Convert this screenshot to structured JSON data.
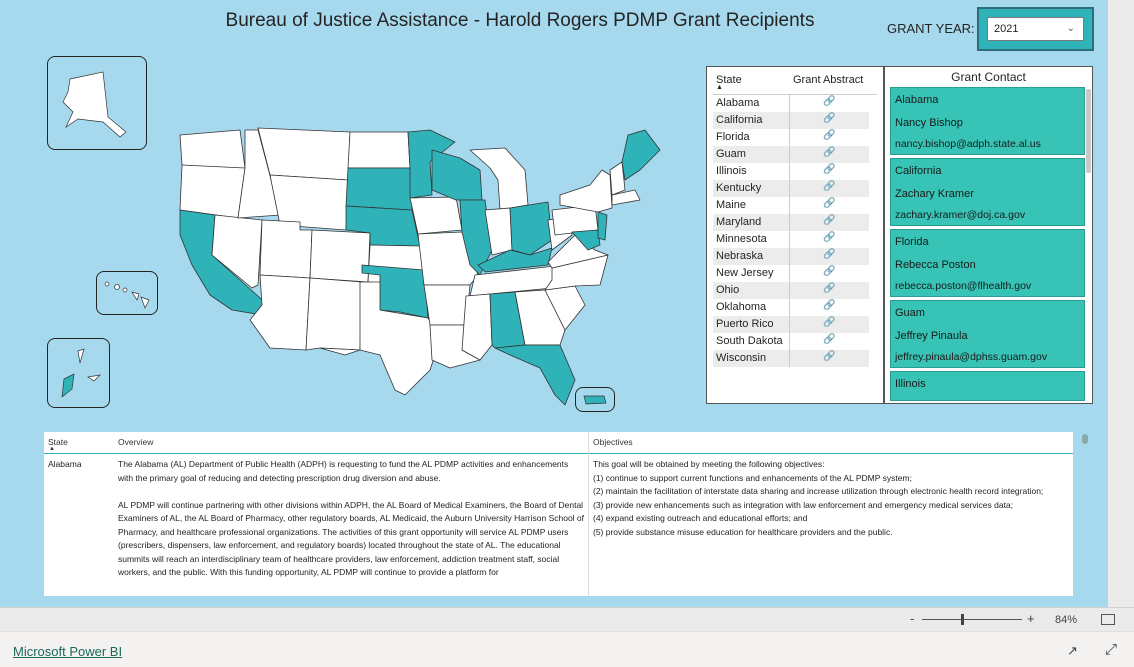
{
  "report": {
    "title": "Bureau of Justice Assistance - Harold Rogers PDMP Grant Recipients",
    "grant_year_label": "GRANT YEAR:",
    "grant_year_value": "2021"
  },
  "colors": {
    "canvas": "#a6d9ee",
    "highlight": "#2fb3b9",
    "state_fill": "#ffffff"
  },
  "state_table": {
    "headers": [
      "State",
      "Grant Abstract"
    ],
    "sort_indicator": "▲",
    "link_icon": "link-icon",
    "rows": [
      "Alabama",
      "California",
      "Florida",
      "Guam",
      "Illinois",
      "Kentucky",
      "Maine",
      "Maryland",
      "Minnesota",
      "Nebraska",
      "New Jersey",
      "Ohio",
      "Oklahoma",
      "Puerto Rico",
      "South Dakota",
      "Wisconsin"
    ]
  },
  "grant_contact": {
    "title": "Grant Contact",
    "cards": [
      {
        "state": "Alabama",
        "name": "Nancy Bishop",
        "email": "nancy.bishop@adph.state.al.us"
      },
      {
        "state": "California",
        "name": "Zachary Kramer",
        "email": "zachary.kramer@doj.ca.gov"
      },
      {
        "state": "Florida",
        "name": "Rebecca Poston",
        "email": "rebecca.poston@flhealth.gov"
      },
      {
        "state": "Guam",
        "name": "Jeffrey Pinaula",
        "email": "jeffrey.pinaula@dphss.guam.gov"
      },
      {
        "state": "Illinois"
      }
    ]
  },
  "details": {
    "headers": {
      "state": "State",
      "overview": "Overview",
      "objectives": "Objectives"
    },
    "row": {
      "state": "Alabama",
      "overview_p1": "The Alabama (AL) Department of Public Health (ADPH) is requesting to fund the AL PDMP activities and enhancements with the primary goal of reducing and detecting prescription drug diversion and abuse.",
      "overview_p2": "AL PDMP will continue partnering with other divisions within ADPH, the AL Board of Medical Examiners, the Board of Dental Examiners of AL, the AL Board of Pharmacy, other regulatory boards, AL Medicaid, the Auburn University Harrison School of Pharmacy, and healthcare professional organizations. The activities of this grant opportunity will service AL PDMP users (prescribers, dispensers, law enforcement, and regulatory boards) located throughout the state of AL. The educational summits will reach an interdisciplinary team of healthcare providers, law enforcement, addiction treatment staff, social workers, and the public. With this funding opportunity, AL PDMP will continue to provide a platform for",
      "objectives": [
        "This goal will be obtained by meeting the following objectives:",
        "(1) continue to support current functions and enhancements of the AL PDMP system;",
        "(2) maintain the facilitation of interstate data sharing and increase utilization through electronic health record integration;",
        "(3) provide new enhancements such as integration with law enforcement and emergency medical services data;",
        "(4) expand existing outreach and educational efforts; and",
        "(5) provide substance misuse education for healthcare providers and the public."
      ]
    }
  },
  "statusbar": {
    "zoom_minus": "-",
    "zoom_plus": "+",
    "zoom_percent": "84%"
  },
  "footer": {
    "brand": "Microsoft Power BI"
  }
}
